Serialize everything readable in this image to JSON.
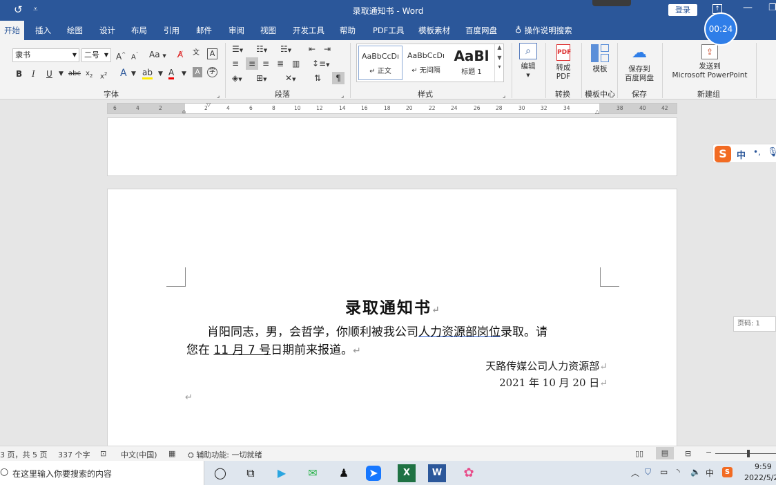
{
  "titlebar": {
    "document_title": "录取通知书",
    "app_name": "Word",
    "title_separator": " - ",
    "login_label": "登录"
  },
  "tabs": [
    {
      "label": "开始",
      "active": true
    },
    {
      "label": "插入"
    },
    {
      "label": "绘图"
    },
    {
      "label": "设计"
    },
    {
      "label": "布局"
    },
    {
      "label": "引用"
    },
    {
      "label": "邮件"
    },
    {
      "label": "审阅"
    },
    {
      "label": "视图"
    },
    {
      "label": "开发工具"
    },
    {
      "label": "帮助"
    },
    {
      "label": "PDF工具"
    },
    {
      "label": "模板素材"
    },
    {
      "label": "百度网盘"
    }
  ],
  "tell_me": "操作说明搜索",
  "timer": "00:24",
  "ribbon": {
    "font_name": "隶书",
    "font_size": "二号",
    "font_group": "字体",
    "paragraph_group": "段落",
    "styles_group": "样式",
    "styles": [
      {
        "preview": "AaBbCcDı",
        "name": "↵ 正文"
      },
      {
        "preview": "AaBbCcDı",
        "name": "↵ 无间隔"
      },
      {
        "preview": "AaBl",
        "name": "标题 1"
      }
    ],
    "editing_label": "编辑",
    "convert_pdf_label_1": "转成",
    "convert_pdf_label_2": "PDF",
    "convert_group": "转换",
    "template_label": "模板",
    "template_group": "模板中心",
    "save_baidu_1": "保存到",
    "save_baidu_2": "百度网盘",
    "save_group": "保存",
    "send_ppt_1": "发送到",
    "send_ppt_2": "Microsoft PowerPoint",
    "new_group": "新建组"
  },
  "ruler": {
    "ticks": [
      "6",
      "4",
      "2",
      "",
      "2",
      "4",
      "6",
      "8",
      "10",
      "12",
      "14",
      "16",
      "18",
      "20",
      "22",
      "24",
      "26",
      "28",
      "30",
      "32",
      "34",
      "",
      "38",
      "40",
      "42"
    ]
  },
  "document": {
    "title": "录取通知书",
    "line1_a": "肖阳同志，男，会哲学，你顺利被我公司",
    "line1_b": "人力资源部岗位",
    "line1_c": "录取。请",
    "line2_a": "您在 ",
    "line2_b": "11 月 7 号",
    "line2_c": "日期前来报道。",
    "signature": "天路传媒公司人力资源部",
    "date": "2021 年 10 月 20 日",
    "para_mark": "↵"
  },
  "page_tooltip": "页码: 1",
  "ime": {
    "zh": "中",
    "dot": "•,"
  },
  "statusbar": {
    "page_info": "3 页，共 5 页",
    "word_count": "337 个字",
    "language": "中文(中国)",
    "accessibility": "辅助功能: 一切就绪"
  },
  "taskbar": {
    "search_placeholder": "在这里输入你要搜索的内容",
    "tray_lang": "中",
    "time": "9:59",
    "date": "2022/5/2"
  },
  "colors": {
    "word_blue": "#2b579a",
    "timer_blue": "#2f7ee8",
    "sogou_orange": "#f26b23"
  }
}
